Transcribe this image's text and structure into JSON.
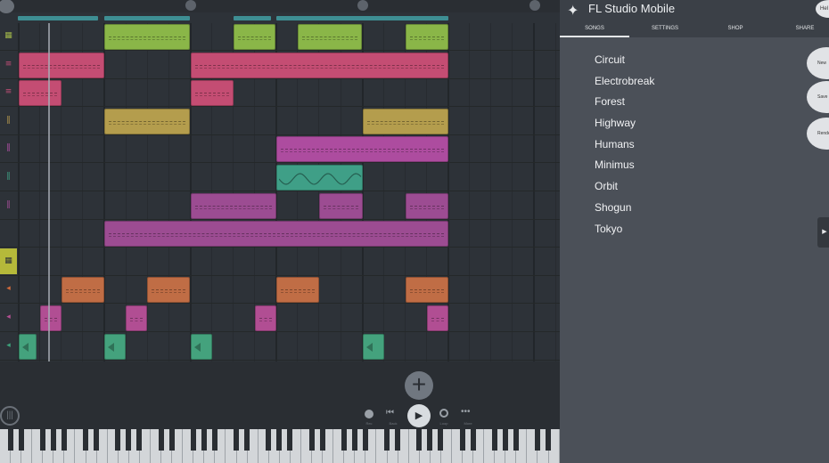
{
  "app": {
    "title": "FL Studio Mobile"
  },
  "menu": {
    "help_label": "Hel",
    "tabs": [
      {
        "label": "SONGS"
      },
      {
        "label": "SETTINGS"
      },
      {
        "label": "SHOP"
      },
      {
        "label": "SHARE"
      }
    ],
    "songs": [
      "Circuit",
      "Electrobreak",
      "Forest",
      "Highway",
      "Humans",
      "Minimus",
      "Orbit",
      "Shogun",
      "Tokyo"
    ],
    "side_buttons": [
      "New",
      "Save",
      "Rende"
    ]
  },
  "ruler": {
    "markers": [
      "",
      "",
      "",
      ""
    ]
  },
  "playlist": {
    "track_icons": [
      {
        "icon": "drum-pad-icon",
        "color": "#9fb54a"
      },
      {
        "icon": "keys-icon",
        "color": "#c44e78"
      },
      {
        "icon": "keys-icon",
        "color": "#c44e78"
      },
      {
        "icon": "piano-icon",
        "color": "#b89a4e"
      },
      {
        "icon": "piano-icon",
        "color": "#b24fa6"
      },
      {
        "icon": "piano-icon",
        "color": "#3e9e83"
      },
      {
        "icon": "piano-icon",
        "color": "#a54e98"
      },
      {
        "icon": "none",
        "color": "#2d3238"
      },
      {
        "icon": "drum-pad-icon",
        "color": "#b8be2e"
      },
      {
        "icon": "audio-clip-icon",
        "color": "#d06a3b"
      },
      {
        "icon": "audio-clip-icon",
        "color": "#b24f91"
      },
      {
        "icon": "audio-clip-icon",
        "color": "#3ca17a"
      }
    ],
    "colors": {
      "lime": "#8ab648",
      "pink": "#c44d73",
      "gold": "#b49d4d",
      "magenta": "#ad4c9f",
      "teal": "#3f9f87",
      "purple": "#9c4c92",
      "orange": "#c06d45",
      "rose": "#b14e93",
      "green": "#44a27d"
    }
  },
  "transport": {
    "labels": [
      "Rec",
      "Back",
      "Play",
      "Loop",
      "More"
    ]
  }
}
